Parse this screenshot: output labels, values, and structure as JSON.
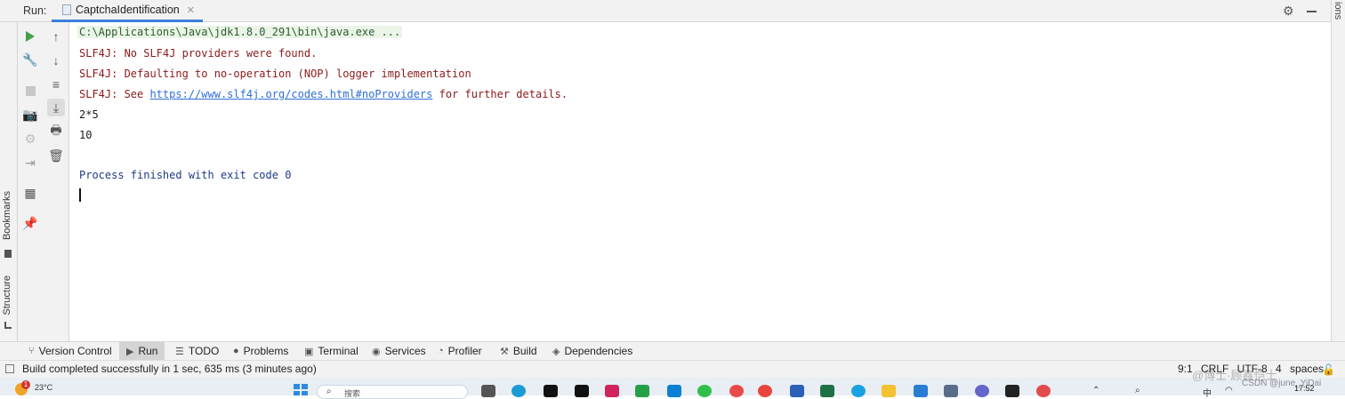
{
  "run_header": {
    "label": "Run:",
    "tab_title": "CaptchaIdentification"
  },
  "right_strip_text": "ions",
  "left_strip": {
    "bookmarks_label": "Bookmarks",
    "structure_label": "Structure"
  },
  "console": {
    "lines": [
      {
        "text": "C:\\Applications\\Java\\jdk1.8.0_291\\bin\\java.exe ...",
        "kind": "cmd"
      },
      {
        "text": "SLF4J: No SLF4J providers were found.",
        "kind": "err"
      },
      {
        "text": "SLF4J: Defaulting to no-operation (NOP) logger implementation",
        "kind": "err"
      },
      {
        "prefix": "SLF4J: See ",
        "link": "https://www.slf4j.org/codes.html#noProviders",
        "suffix": " for further details.",
        "kind": "err"
      },
      {
        "text": "2*5",
        "kind": "out"
      },
      {
        "text": "10",
        "kind": "out"
      },
      {
        "text": "Process finished with exit code 0",
        "kind": "fin"
      }
    ]
  },
  "tool_tabs": [
    {
      "label": "Version Control",
      "icon": "branch-icon"
    },
    {
      "label": "Run",
      "icon": "run-icon",
      "active": true
    },
    {
      "label": "TODO",
      "icon": "list-icon"
    },
    {
      "label": "Problems",
      "icon": "info-icon"
    },
    {
      "label": "Terminal",
      "icon": "terminal-icon"
    },
    {
      "label": "Services",
      "icon": "services-icon"
    },
    {
      "label": "Profiler",
      "icon": "profiler-icon"
    },
    {
      "label": "Build",
      "icon": "hammer-icon"
    },
    {
      "label": "Dependencies",
      "icon": "layers-icon"
    }
  ],
  "status_bar": {
    "message": "Build completed successfully in 1 sec, 635 ms (3 minutes ago)",
    "position": "9:1 CRLF UTF-8 4 spaces"
  },
  "taskbar": {
    "weather_badge": "1",
    "temperature": "23°C",
    "search_text": "搜索",
    "clock": "17:52"
  },
  "watermark": {
    "line1": "@博士·顾鑫恺士",
    "line2": "CSDN @june_YiDai"
  }
}
